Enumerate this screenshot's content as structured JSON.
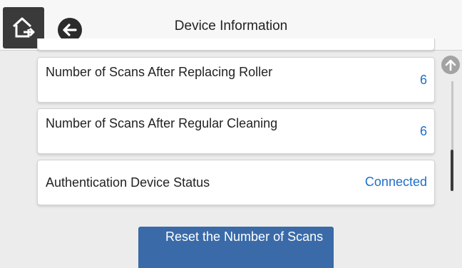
{
  "header": {
    "title": "Device Information",
    "home_icon": "home-icon",
    "back_icon": "arrow-left-icon"
  },
  "rows": [
    {
      "label": "Number of Scans After Replacing Roller",
      "value": "6"
    },
    {
      "label": "Number of Scans After Regular Cleaning",
      "value": "6"
    },
    {
      "label": "Authentication Device Status",
      "value": "Connected"
    }
  ],
  "reset_button": {
    "label": "Reset the Number of Scans"
  },
  "colors": {
    "accent_value": "#1f6fc9",
    "button": "#3a6aa8",
    "header_button": "#3a3a3a"
  }
}
